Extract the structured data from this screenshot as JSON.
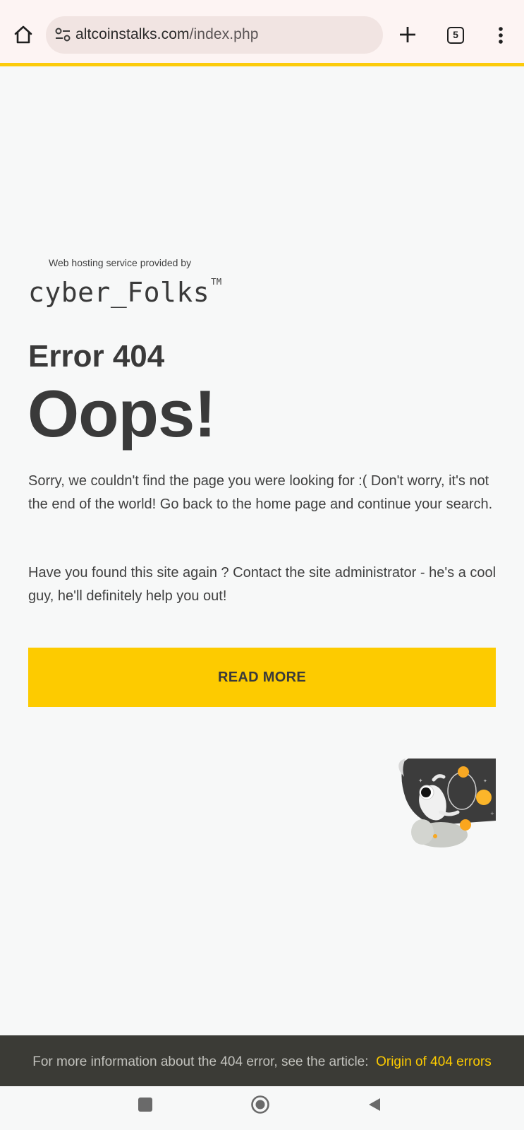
{
  "browser": {
    "url_domain": "altcoinstalks.com",
    "url_path": "/index.php",
    "tab_count": "5",
    "accent_color": "#fccb0b"
  },
  "page": {
    "hosting_label": "Web hosting service provided by",
    "brand_name": "cyber_Folks",
    "brand_tm": "TM",
    "error_code": "Error 404",
    "headline": "Oops!",
    "paragraph_1": "Sorry, we couldn't find the page you were looking for :( Don't worry, it's not the end of the world! Go back to the home page and continue your search.",
    "paragraph_2": "Have you found this site again ? Contact the site administrator - he's a cool guy, he'll definitely help you out!",
    "button_label": "READ MORE",
    "button_color": "#fdcb00",
    "illustration": "astronaut-in-space-illustration"
  },
  "footer": {
    "text": "For more information about the 404 error, see the article:",
    "link_text": "Origin of 404 errors",
    "background": "#3b3b36"
  },
  "system_nav": {
    "icons": [
      "recent-apps-icon",
      "home-circle-icon",
      "back-triangle-icon"
    ]
  }
}
